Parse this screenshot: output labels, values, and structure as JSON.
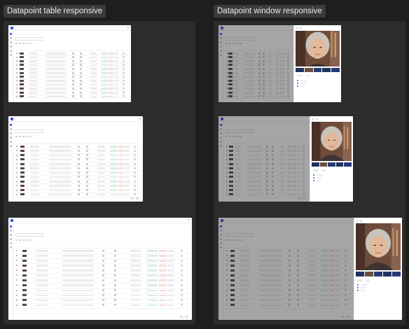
{
  "sections": {
    "table": {
      "label": "Datapoint table responsive"
    },
    "window": {
      "label": "Datapoint window responsive"
    }
  }
}
